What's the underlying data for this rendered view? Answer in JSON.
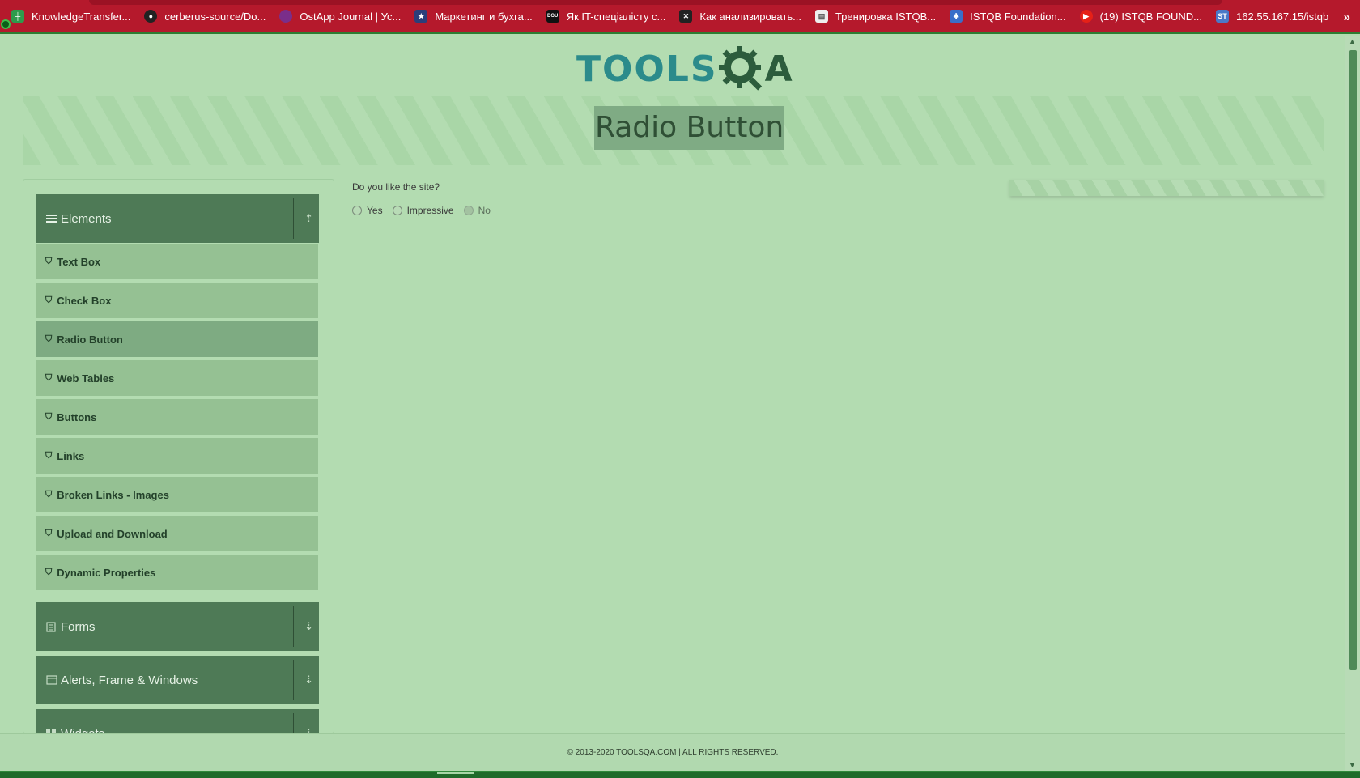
{
  "bookmarks": [
    {
      "label": "KnowledgeTransfer...",
      "icon": "green-flag-icon",
      "color": "#2e9b4c"
    },
    {
      "label": "cerberus-source/Do...",
      "icon": "github-icon",
      "color": "#222222"
    },
    {
      "label": "OstApp Journal | Ус...",
      "icon": "ostapp-icon",
      "color": "#7a2e8a"
    },
    {
      "label": "Маркетинг и бухга...",
      "icon": "star-icon",
      "color": "#2a3e7a"
    },
    {
      "label": "Як IT-спеціалісту с...",
      "icon": "dou-icon",
      "color": "#111111"
    },
    {
      "label": "Как анализировать...",
      "icon": "cross-icon",
      "color": "#222222"
    },
    {
      "label": "Тренировка ISTQB...",
      "icon": "document-icon",
      "color": "#eeeeee"
    },
    {
      "label": "ISTQB Foundation...",
      "icon": "gear-badge-icon",
      "color": "#3a6ec9"
    },
    {
      "label": "(19) ISTQB FOUND...",
      "icon": "youtube-icon",
      "color": "#e62117"
    },
    {
      "label": "162.55.167.15/istqb",
      "icon": "st-icon",
      "color": "#4a78c8"
    }
  ],
  "bookmarks_more": "»",
  "logo": {
    "text": "TOOLS",
    "suffix": "A"
  },
  "page_title": "Radio Button",
  "sidebar": {
    "groups": [
      {
        "label": "Elements",
        "icon": "hamburger-icon",
        "arrow": "⇡"
      },
      {
        "label": "Forms",
        "icon": "form-icon",
        "arrow": "⇣"
      },
      {
        "label": "Alerts, Frame & Windows",
        "icon": "window-icon",
        "arrow": "⇣"
      },
      {
        "label": "Widgets",
        "icon": "widgets-icon",
        "arrow": "⇣"
      }
    ],
    "items": [
      {
        "label": "Text Box",
        "active": false
      },
      {
        "label": "Check Box",
        "active": false
      },
      {
        "label": "Radio Button",
        "active": true
      },
      {
        "label": "Web Tables",
        "active": false
      },
      {
        "label": "Buttons",
        "active": false
      },
      {
        "label": "Links",
        "active": false
      },
      {
        "label": "Broken Links - Images",
        "active": false
      },
      {
        "label": "Upload and Download",
        "active": false
      },
      {
        "label": "Dynamic Properties",
        "active": false
      }
    ]
  },
  "main": {
    "question": "Do you like the site?",
    "options": [
      {
        "label": "Yes",
        "disabled": false
      },
      {
        "label": "Impressive",
        "disabled": false
      },
      {
        "label": "No",
        "disabled": true
      }
    ]
  },
  "footer": "© 2013-2020 TOOLSQA.COM | ALL RIGHTS RESERVED.",
  "colors": {
    "bookmark_bar": "#b5192c",
    "page_bg": "#b3dcb1",
    "group_header": "#4e7a56",
    "menu_item": "#95c193",
    "active_item": "#7eab82"
  }
}
